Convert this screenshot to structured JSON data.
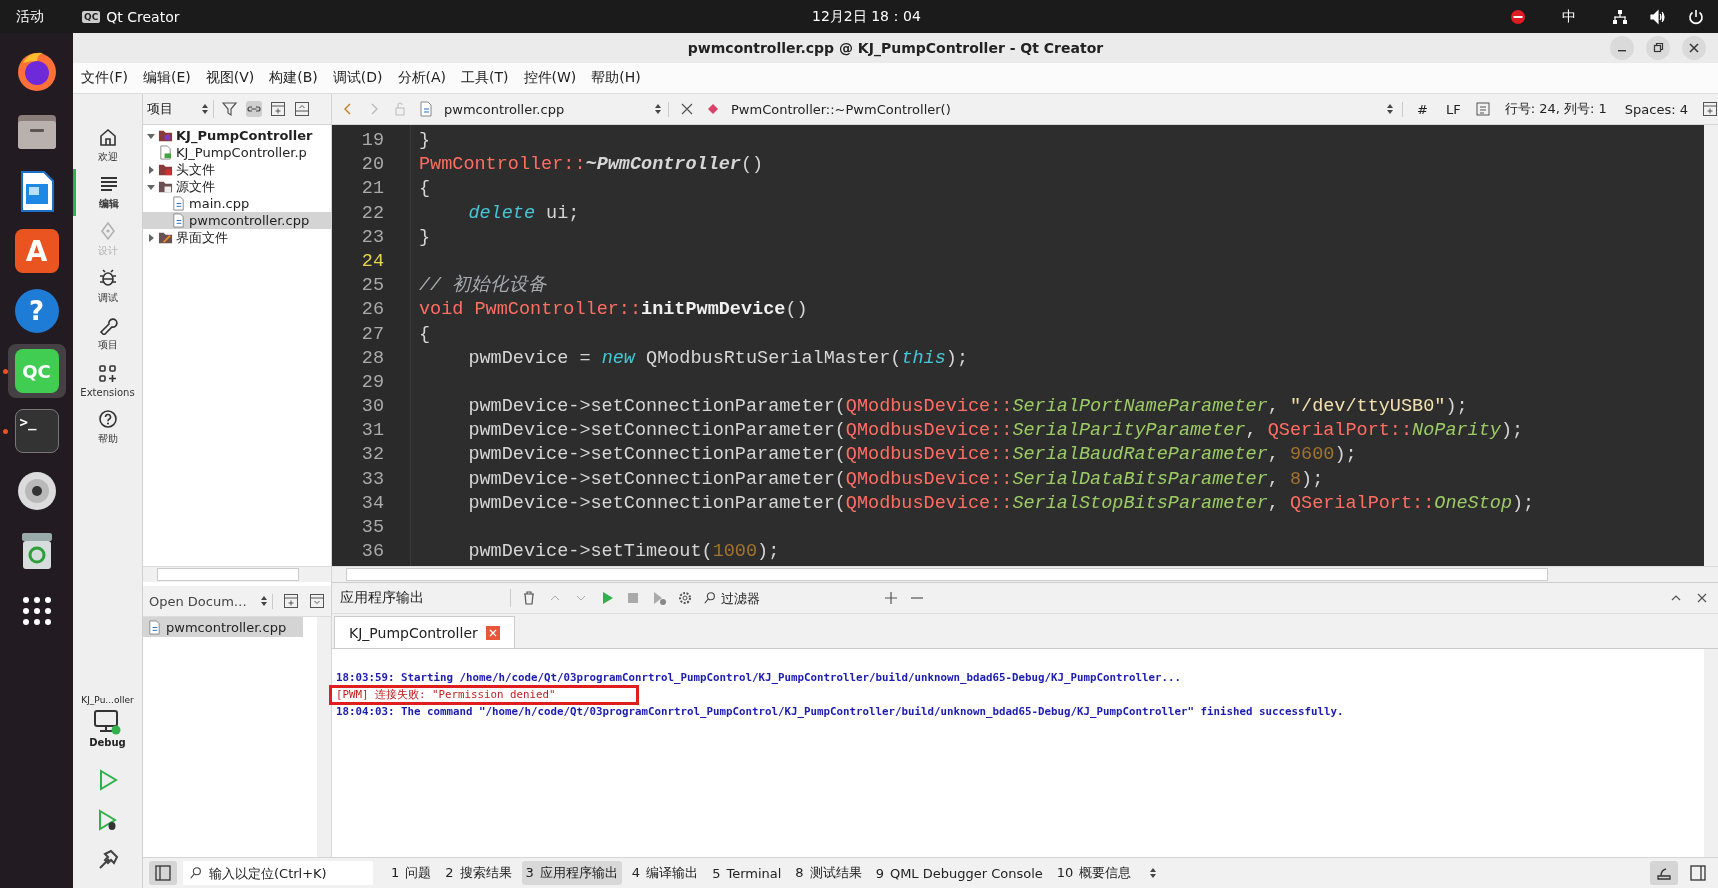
{
  "top_bar": {
    "activities": "活动",
    "app_glyph": "QC",
    "app": "Qt Creator",
    "clock": "12月2日 18：04",
    "input_method": "中"
  },
  "dock": [
    {
      "kind": "firefox",
      "selected": false,
      "running": false
    },
    {
      "kind": "files",
      "selected": false,
      "running": false
    },
    {
      "kind": "writer",
      "selected": false,
      "running": false
    },
    {
      "kind": "appcenter",
      "glyph": "A",
      "selected": false,
      "running": false
    },
    {
      "kind": "help",
      "glyph": "?",
      "selected": false,
      "running": false
    },
    {
      "kind": "qtcreator",
      "glyph": "QC",
      "selected": true,
      "running": true
    },
    {
      "kind": "terminal",
      "glyph": ">_",
      "selected": false,
      "running": true
    },
    {
      "kind": "disc",
      "selected": false,
      "running": false
    },
    {
      "kind": "trash",
      "selected": false,
      "running": false
    },
    {
      "kind": "apps",
      "selected": false,
      "running": false
    }
  ],
  "window": {
    "title": "pwmcontroller.cpp @ KJ_PumpController - Qt Creator"
  },
  "menu": [
    "文件(F)",
    "编辑(E)",
    "视图(V)",
    "构建(B)",
    "调试(D)",
    "分析(A)",
    "工具(T)",
    "控件(W)",
    "帮助(H)"
  ],
  "modes": [
    {
      "kind": "home",
      "label": "欢迎",
      "selected": false,
      "disabled": false
    },
    {
      "kind": "edit",
      "label": "编辑",
      "selected": true,
      "disabled": false
    },
    {
      "kind": "design",
      "label": "设计",
      "selected": false,
      "disabled": true
    },
    {
      "kind": "debug",
      "label": "调试",
      "selected": false,
      "disabled": false
    },
    {
      "kind": "project",
      "label": "项目",
      "selected": false,
      "disabled": false
    },
    {
      "kind": "extensions",
      "label": "Extensions",
      "selected": false,
      "disabled": false
    },
    {
      "kind": "help",
      "label": "帮助",
      "selected": false,
      "disabled": false
    }
  ],
  "kit": {
    "project": "KJ_Pu...oller",
    "build": "Debug"
  },
  "project_panel": {
    "selector": "项目",
    "tree": [
      {
        "label": "KJ_PumpController",
        "kind": "project",
        "expanded": true,
        "selected": false,
        "children": [
          {
            "label": "KJ_PumpController.p",
            "kind": "pro",
            "selected": false
          },
          {
            "label": "头文件",
            "kind": "header_folder",
            "expanded": false,
            "selected": false
          },
          {
            "label": "源文件",
            "kind": "source_folder",
            "expanded": true,
            "selected": false,
            "children": [
              {
                "label": "main.cpp",
                "kind": "cpp",
                "selected": false
              },
              {
                "label": "pwmcontroller.cpp",
                "kind": "cpp",
                "selected": true
              }
            ]
          },
          {
            "label": "界面文件",
            "kind": "form_folder",
            "expanded": false,
            "selected": false
          }
        ]
      }
    ]
  },
  "open_documents": {
    "title": "Open Docum…",
    "items": [
      {
        "name": "pwmcontroller.cpp",
        "selected": true
      }
    ]
  },
  "editor": {
    "file": "pwmcontroller.cpp",
    "symbol": "PwmController::~PwmController()",
    "hash": "#",
    "line_ending": "LF",
    "position": "行号: 24, 列号: 1",
    "indent": "Spaces: 4",
    "lines": [
      {
        "number": "19",
        "current": false,
        "indented": false,
        "tokens": [
          {
            "kind": "plain",
            "text": "}"
          }
        ]
      },
      {
        "number": "20",
        "current": false,
        "indented": false,
        "tokens": [
          {
            "kind": "type",
            "text": "PwmController::"
          },
          {
            "kind": "decl",
            "text": "~PwmController"
          },
          {
            "kind": "plain",
            "text": "()"
          }
        ]
      },
      {
        "number": "21",
        "current": false,
        "indented": false,
        "tokens": [
          {
            "kind": "plain",
            "text": "{"
          }
        ]
      },
      {
        "number": "22",
        "current": false,
        "indented": true,
        "tokens": [
          {
            "kind": "keyword",
            "text": "delete"
          },
          {
            "kind": "plain",
            "text": " ui;"
          }
        ]
      },
      {
        "number": "23",
        "current": false,
        "indented": false,
        "tokens": [
          {
            "kind": "plain",
            "text": "}"
          }
        ]
      },
      {
        "number": "24",
        "current": true
      },
      {
        "number": "25",
        "current": false,
        "indented": false,
        "tokens": [
          {
            "kind": "comment",
            "text": "// 初始化设备"
          }
        ]
      },
      {
        "number": "26",
        "current": false,
        "indented": false,
        "tokens": [
          {
            "kind": "primitive",
            "text": "void "
          },
          {
            "kind": "type",
            "text": "PwmController::"
          },
          {
            "kind": "function",
            "text": "initPwmDevice"
          },
          {
            "kind": "plain",
            "text": "()"
          }
        ]
      },
      {
        "number": "27",
        "current": false,
        "indented": false,
        "tokens": [
          {
            "kind": "plain",
            "text": "{"
          }
        ]
      },
      {
        "number": "28",
        "current": false,
        "indented": true,
        "tokens": [
          {
            "kind": "plain",
            "text": "pwmDevice = "
          },
          {
            "kind": "keyword",
            "text": "new"
          },
          {
            "kind": "plain",
            "text": " QModbusRtuSerialMaster("
          },
          {
            "kind": "keyword",
            "text": "this"
          },
          {
            "kind": "plain",
            "text": ");"
          }
        ]
      },
      {
        "number": "29",
        "current": false
      },
      {
        "number": "30",
        "current": false,
        "indented": true,
        "tokens": [
          {
            "kind": "plain",
            "text": "pwmDevice->setConnectionParameter("
          },
          {
            "kind": "type",
            "text": "QModbusDevice::"
          },
          {
            "kind": "enum",
            "text": "SerialPortNameParameter"
          },
          {
            "kind": "plain",
            "text": ", "
          },
          {
            "kind": "string",
            "text": "\"/dev/ttyUSB0\""
          },
          {
            "kind": "plain",
            "text": ");"
          }
        ]
      },
      {
        "number": "31",
        "current": false,
        "indented": true,
        "tokens": [
          {
            "kind": "plain",
            "text": "pwmDevice->setConnectionParameter("
          },
          {
            "kind": "type",
            "text": "QModbusDevice::"
          },
          {
            "kind": "enum",
            "text": "SerialParityParameter"
          },
          {
            "kind": "plain",
            "text": ", "
          },
          {
            "kind": "type",
            "text": "QSerialPort::"
          },
          {
            "kind": "enum",
            "text": "NoParity"
          },
          {
            "kind": "plain",
            "text": ");"
          }
        ]
      },
      {
        "number": "32",
        "current": false,
        "indented": true,
        "tokens": [
          {
            "kind": "plain",
            "text": "pwmDevice->setConnectionParameter("
          },
          {
            "kind": "type",
            "text": "QModbusDevice::"
          },
          {
            "kind": "enum",
            "text": "SerialBaudRateParameter"
          },
          {
            "kind": "plain",
            "text": ", "
          },
          {
            "kind": "number",
            "text": "9600"
          },
          {
            "kind": "plain",
            "text": ");"
          }
        ]
      },
      {
        "number": "33",
        "current": false,
        "indented": true,
        "tokens": [
          {
            "kind": "plain",
            "text": "pwmDevice->setConnectionParameter("
          },
          {
            "kind": "type",
            "text": "QModbusDevice::"
          },
          {
            "kind": "enum",
            "text": "SerialDataBitsParameter"
          },
          {
            "kind": "plain",
            "text": ", "
          },
          {
            "kind": "number",
            "text": "8"
          },
          {
            "kind": "plain",
            "text": ");"
          }
        ]
      },
      {
        "number": "34",
        "current": false,
        "indented": true,
        "tokens": [
          {
            "kind": "plain",
            "text": "pwmDevice->setConnectionParameter("
          },
          {
            "kind": "type",
            "text": "QModbusDevice::"
          },
          {
            "kind": "enum",
            "text": "SerialStopBitsParameter"
          },
          {
            "kind": "plain",
            "text": ", "
          },
          {
            "kind": "type",
            "text": "QSerialPort::"
          },
          {
            "kind": "enum",
            "text": "OneStop"
          },
          {
            "kind": "plain",
            "text": ");"
          }
        ]
      },
      {
        "number": "35",
        "current": false
      },
      {
        "number": "36",
        "current": false,
        "indented": true,
        "tokens": [
          {
            "kind": "plain",
            "text": "pwmDevice->setTimeout("
          },
          {
            "kind": "number",
            "text": "1000"
          },
          {
            "kind": "plain",
            "text": ");"
          }
        ]
      }
    ]
  },
  "output": {
    "title": "应用程序输出",
    "filter_placeholder": "过滤器",
    "tabs": [
      {
        "label": "KJ_PumpController",
        "selected": true
      }
    ],
    "lines": [
      {
        "kind": "info",
        "boxed": false,
        "text": "18:03:59: Starting /home/h/code/Qt/03programConrtrol_PumpControl/KJ_PumpController/build/unknown_bdad65-Debug/KJ_PumpController..."
      },
      {
        "kind": "error",
        "boxed": true,
        "text": "[PWM] 连接失败: \"Permission denied\""
      },
      {
        "kind": "info",
        "boxed": false,
        "text": "18:04:03: The command \"/home/h/code/Qt/03programConrtrol_PumpControl/KJ_PumpController/build/unknown_bdad65-Debug/KJ_PumpController\" finished successfully."
      }
    ]
  },
  "status_bar": {
    "locator_placeholder": "输入以定位(Ctrl+K)",
    "panes": [
      {
        "number": "1",
        "label": "问题",
        "selected": false
      },
      {
        "number": "2",
        "label": "搜索结果",
        "selected": false
      },
      {
        "number": "3",
        "label": "应用程序输出",
        "selected": true
      },
      {
        "number": "4",
        "label": "编译输出",
        "selected": false
      },
      {
        "number": "5",
        "label": "Terminal",
        "selected": false
      },
      {
        "number": "8",
        "label": "测试结果",
        "selected": false
      },
      {
        "number": "9",
        "label": "QML Debugger Console",
        "selected": false
      },
      {
        "number": "10",
        "label": "概要信息",
        "selected": false
      }
    ]
  }
}
